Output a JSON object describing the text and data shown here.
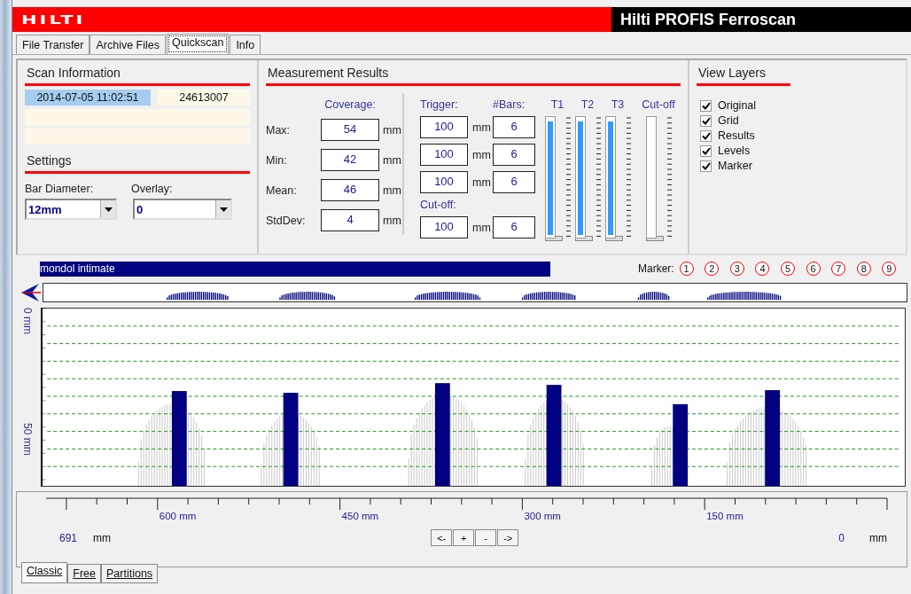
{
  "header": {
    "logo": "HILTI",
    "title": "Hilti PROFIS Ferroscan"
  },
  "tabs": [
    {
      "label": "File Transfer",
      "selected": false
    },
    {
      "label": "Archive Files",
      "selected": false
    },
    {
      "label": "Quickscan",
      "selected": true
    },
    {
      "label": "Info",
      "selected": false
    }
  ],
  "scan_information": {
    "title": "Scan Information",
    "date": "2014-07-05 11:02:51",
    "serial": "24613007"
  },
  "settings": {
    "title": "Settings",
    "bar_diameter": {
      "label": "Bar Diameter:",
      "value": "12mm"
    },
    "overlay": {
      "label": "Overlay:",
      "value": "0"
    }
  },
  "measurement_results": {
    "title": "Measurement Results",
    "coverage_heading": "Coverage:",
    "coverage": [
      {
        "label": "Max:",
        "value": "54",
        "unit": "mm"
      },
      {
        "label": "Min:",
        "value": "42",
        "unit": "mm"
      },
      {
        "label": "Mean:",
        "value": "46",
        "unit": "mm"
      },
      {
        "label": "StdDev:",
        "value": "4",
        "unit": "mm"
      }
    ],
    "trigger_heading": "Trigger:",
    "bars_heading": "#Bars:",
    "triggers": [
      {
        "value": "100",
        "unit": "mm",
        "bars": "6"
      },
      {
        "value": "100",
        "unit": "mm",
        "bars": "6"
      },
      {
        "value": "100",
        "unit": "mm",
        "bars": "6"
      }
    ],
    "cutoff_heading": "Cut-off:",
    "cutoff": {
      "value": "100",
      "unit": "mm",
      "bars": "6"
    },
    "sliders": [
      {
        "label": "T1",
        "level": 1
      },
      {
        "label": "T2",
        "level": 1
      },
      {
        "label": "T3",
        "level": 1
      },
      {
        "label": "Cut-off",
        "level": 0
      }
    ]
  },
  "view_layers": {
    "title": "View Layers",
    "items": [
      {
        "label": "Original",
        "checked": true
      },
      {
        "label": "Grid",
        "checked": true
      },
      {
        "label": "Results",
        "checked": true
      },
      {
        "label": "Levels",
        "checked": true
      },
      {
        "label": "Marker",
        "checked": true
      }
    ]
  },
  "scan": {
    "name": "mondol intimate",
    "marker_label": "Marker:",
    "markers": [
      "1",
      "2",
      "3",
      "4",
      "5",
      "6",
      "7",
      "8",
      "9"
    ],
    "y_labels": [
      "0 mm",
      "50 mm"
    ]
  },
  "ruler": {
    "labels": [
      "600 mm",
      "450 mm",
      "300 mm",
      "150 mm"
    ],
    "start": "691",
    "start_unit": "mm",
    "end": "0",
    "end_unit": "mm",
    "nav_buttons": [
      "<-",
      "+",
      "-",
      "->"
    ]
  },
  "view_tabs": [
    {
      "label": "Classic",
      "selected": true
    },
    {
      "label": "Free",
      "selected": false
    },
    {
      "label": "Partitions",
      "selected": false
    }
  ]
}
